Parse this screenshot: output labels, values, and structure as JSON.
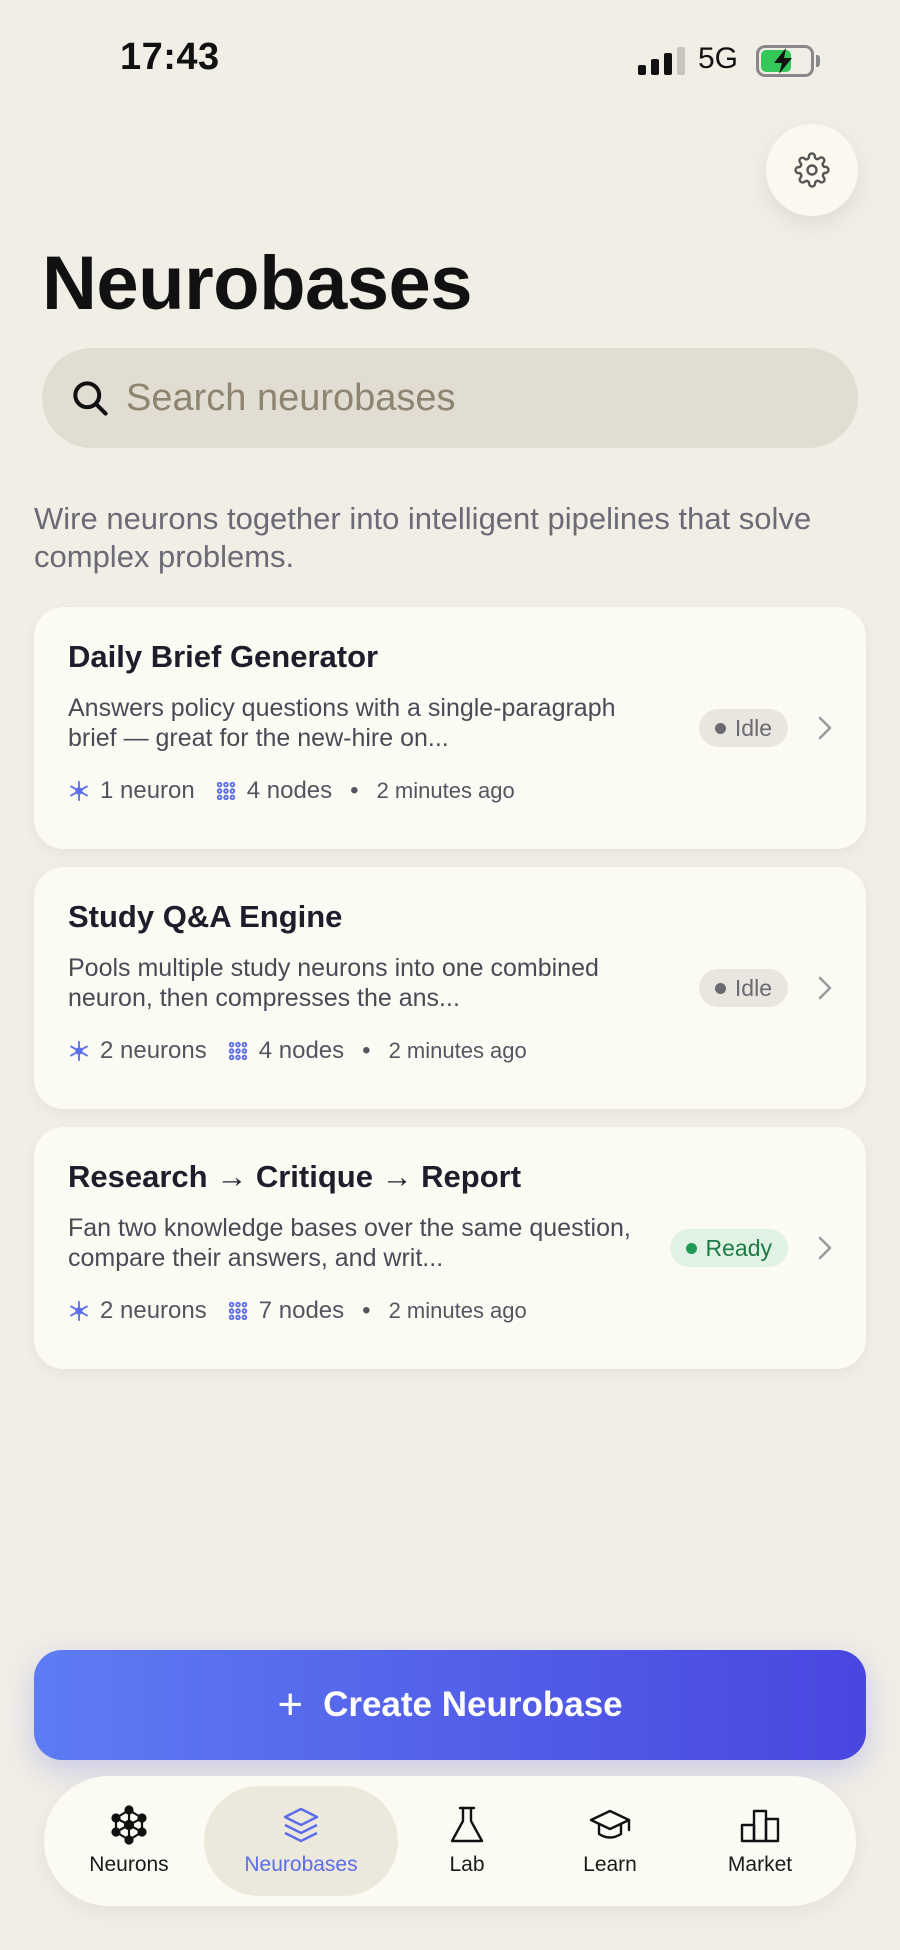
{
  "status_bar": {
    "time": "17:43",
    "network": "5G"
  },
  "page_title": "Neurobases",
  "search": {
    "placeholder": "Search neurobases",
    "value": ""
  },
  "intro_text": "Wire neurons together into intelligent pipelines that solve complex problems.",
  "cards": [
    {
      "title": "Daily Brief Generator",
      "description": "Answers policy questions with a single-paragraph brief — great for the new-hire on...",
      "neurons": "1 neuron",
      "nodes": "4 nodes",
      "separator": "•",
      "updated": "2 minutes ago",
      "status": "Idle"
    },
    {
      "title": "Study Q&A Engine",
      "description": "Pools multiple study neurons into one combined neuron, then compresses the ans...",
      "neurons": "2 neurons",
      "nodes": "4 nodes",
      "separator": "•",
      "updated": "2 minutes ago",
      "status": "Idle"
    },
    {
      "title": "Research → Critique → Report",
      "description": "Fan two knowledge bases over the same question, compare their answers, and writ...",
      "neurons": "2 neurons",
      "nodes": "7 nodes",
      "separator": "•",
      "updated": "2 minutes ago",
      "status": "Ready"
    }
  ],
  "create_button": {
    "icon": "+",
    "label": "Create Neurobase"
  },
  "tabs": [
    {
      "label": "Neurons",
      "icon": "neuron-network-icon"
    },
    {
      "label": "Neurobases",
      "icon": "layers-icon",
      "active": true
    },
    {
      "label": "Lab",
      "icon": "flask-icon"
    },
    {
      "label": "Learn",
      "icon": "graduation-cap-icon"
    },
    {
      "label": "Market",
      "icon": "podium-icon"
    }
  ],
  "colors": {
    "background": "#f1eee6",
    "accent": "#5b6de8",
    "ready": "#1f7a44",
    "idle": "#6b6a70"
  }
}
